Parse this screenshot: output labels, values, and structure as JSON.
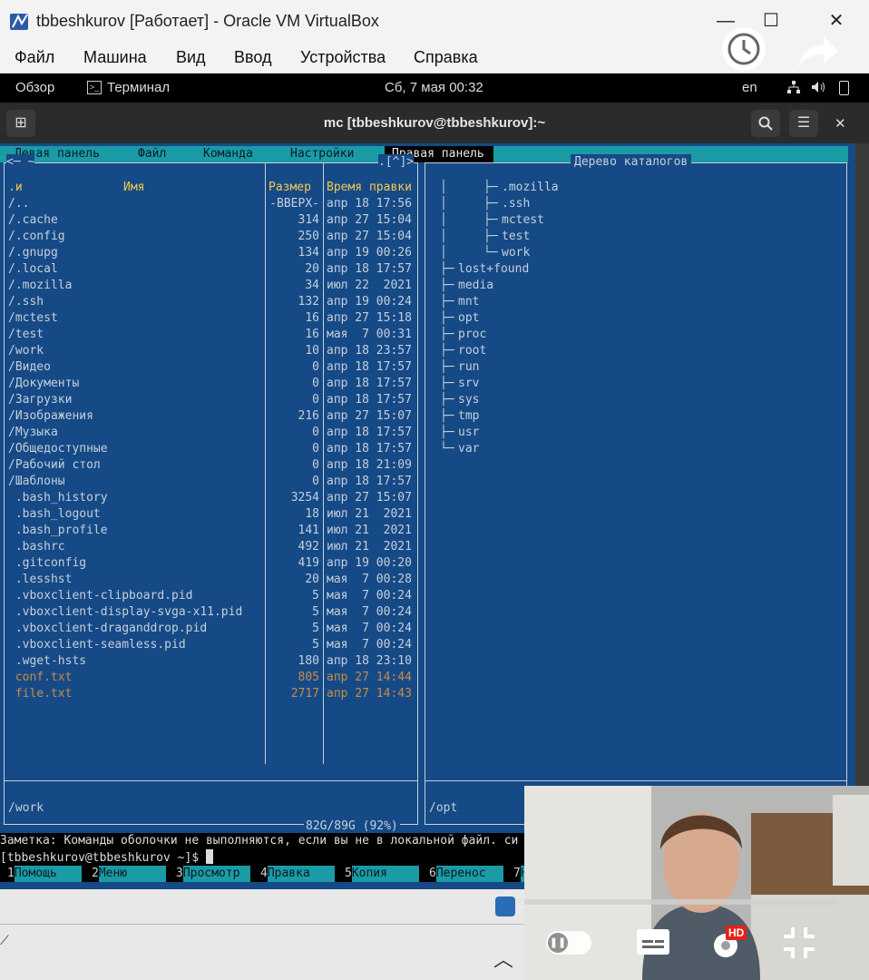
{
  "window": {
    "title": "tbbeshkurov [Работает] - Oracle VM VirtualBox",
    "min": "—",
    "max": "☐",
    "close": "✕"
  },
  "vbox_menu": [
    "Файл",
    "Машина",
    "Вид",
    "Ввод",
    "Устройства",
    "Справка"
  ],
  "gnome_bar": {
    "overview": "Обзор",
    "app": "Терминал",
    "clock": "Сб, 7 мая  00:32",
    "lang": "en"
  },
  "terminal": {
    "title": "mc [tbbeshkurov@tbbeshkurov]:~",
    "new_tab": "⊞",
    "search": "⌕",
    "menu": "☰",
    "close": "✕"
  },
  "mc": {
    "menubar": {
      "left": "Левая панель",
      "file": "Файл",
      "command": "Команда",
      "options": "Настройки",
      "right": "Правая панель"
    },
    "left_panel": {
      "path_left": "<─ ~",
      "path_right": ".[^]>",
      "headers": {
        "sort": ".и",
        "name": "Имя",
        "size": "Размер",
        "time": "Время правки"
      },
      "rows": [
        {
          "name": "/..",
          "size": "-ВВЕРХ-",
          "time": "апр 18 17:56"
        },
        {
          "name": "/.cache",
          "size": "314",
          "time": "апр 27 15:04"
        },
        {
          "name": "/.config",
          "size": "250",
          "time": "апр 27 15:04"
        },
        {
          "name": "/.gnupg",
          "size": "134",
          "time": "апр 19 00:26"
        },
        {
          "name": "/.local",
          "size": "20",
          "time": "апр 18 17:57"
        },
        {
          "name": "/.mozilla",
          "size": "34",
          "time": "июл 22  2021"
        },
        {
          "name": "/.ssh",
          "size": "132",
          "time": "апр 19 00:24"
        },
        {
          "name": "/mctest",
          "size": "16",
          "time": "апр 27 15:18"
        },
        {
          "name": "/test",
          "size": "16",
          "time": "мая  7 00:31"
        },
        {
          "name": "/work",
          "size": "10",
          "time": "апр 18 23:57"
        },
        {
          "name": "/Видео",
          "size": "0",
          "time": "апр 18 17:57"
        },
        {
          "name": "/Документы",
          "size": "0",
          "time": "апр 18 17:57"
        },
        {
          "name": "/Загрузки",
          "size": "0",
          "time": "апр 18 17:57"
        },
        {
          "name": "/Изображения",
          "size": "216",
          "time": "апр 27 15:07"
        },
        {
          "name": "/Музыка",
          "size": "0",
          "time": "апр 18 17:57"
        },
        {
          "name": "/Общедоступные",
          "size": "0",
          "time": "апр 18 17:57"
        },
        {
          "name": "/Рабочий стол",
          "size": "0",
          "time": "апр 18 21:09"
        },
        {
          "name": "/Шаблоны",
          "size": "0",
          "time": "апр 18 17:57"
        },
        {
          "name": " .bash_history",
          "size": "3254",
          "time": "апр 27 15:07"
        },
        {
          "name": " .bash_logout",
          "size": "18",
          "time": "июл 21  2021"
        },
        {
          "name": " .bash_profile",
          "size": "141",
          "time": "июл 21  2021"
        },
        {
          "name": " .bashrc",
          "size": "492",
          "time": "июл 21  2021"
        },
        {
          "name": " .gitconfig",
          "size": "419",
          "time": "апр 19 00:20"
        },
        {
          "name": " .lesshst",
          "size": "20",
          "time": "мая  7 00:28"
        },
        {
          "name": " .vboxclient-clipboard.pid",
          "size": "5",
          "time": "мая  7 00:24"
        },
        {
          "name": " .vboxclient-display-svga-x11.pid",
          "size": "5",
          "time": "мая  7 00:24"
        },
        {
          "name": " .vboxclient-draganddrop.pid",
          "size": "5",
          "time": "мая  7 00:24"
        },
        {
          "name": " .vboxclient-seamless.pid",
          "size": "5",
          "time": "мая  7 00:24"
        },
        {
          "name": " .wget-hsts",
          "size": "180",
          "time": "апр 18 23:10"
        },
        {
          "name": " conf.txt",
          "size": "805",
          "time": "апр 27 14:44",
          "dim": true
        },
        {
          "name": " file.txt",
          "size": "2717",
          "time": "апр 27 14:43",
          "dim": true
        }
      ],
      "status": "/work",
      "disk": "82G/89G (92%)"
    },
    "right_panel": {
      "title": "Дерево каталогов",
      "tree": [
        {
          "text": ".mozilla",
          "indent": 2
        },
        {
          "text": ".ssh",
          "indent": 2
        },
        {
          "text": "mctest",
          "indent": 2
        },
        {
          "text": "test",
          "indent": 2
        },
        {
          "text": "work",
          "indent": 2,
          "last": true
        },
        {
          "text": "lost+found",
          "indent": 0
        },
        {
          "text": "media",
          "indent": 0
        },
        {
          "text": "mnt",
          "indent": 0
        },
        {
          "text": "opt",
          "indent": 0
        },
        {
          "text": "proc",
          "indent": 0
        },
        {
          "text": "root",
          "indent": 0
        },
        {
          "text": "run",
          "indent": 0
        },
        {
          "text": "srv",
          "indent": 0
        },
        {
          "text": "sys",
          "indent": 0
        },
        {
          "text": "tmp",
          "indent": 0
        },
        {
          "text": "usr",
          "indent": 0
        },
        {
          "text": "var",
          "indent": 0,
          "last": true
        }
      ],
      "status": "/opt"
    },
    "hint": "Заметка: Команды оболочки не выполняются, если вы не в локальной файл. си",
    "prompt": "[tbbeshkurov@tbbeshkurov ~]$ ",
    "fkeys": [
      {
        "n": "1",
        "l": "Помощь"
      },
      {
        "n": "2",
        "l": "Меню"
      },
      {
        "n": "3",
        "l": "Просмотр"
      },
      {
        "n": "4",
        "l": "Правка"
      },
      {
        "n": "5",
        "l": "Копия"
      },
      {
        "n": "6",
        "l": "Перенос"
      },
      {
        "n": "7",
        "l": "Н"
      }
    ]
  },
  "pip": {
    "badge": "HD"
  }
}
